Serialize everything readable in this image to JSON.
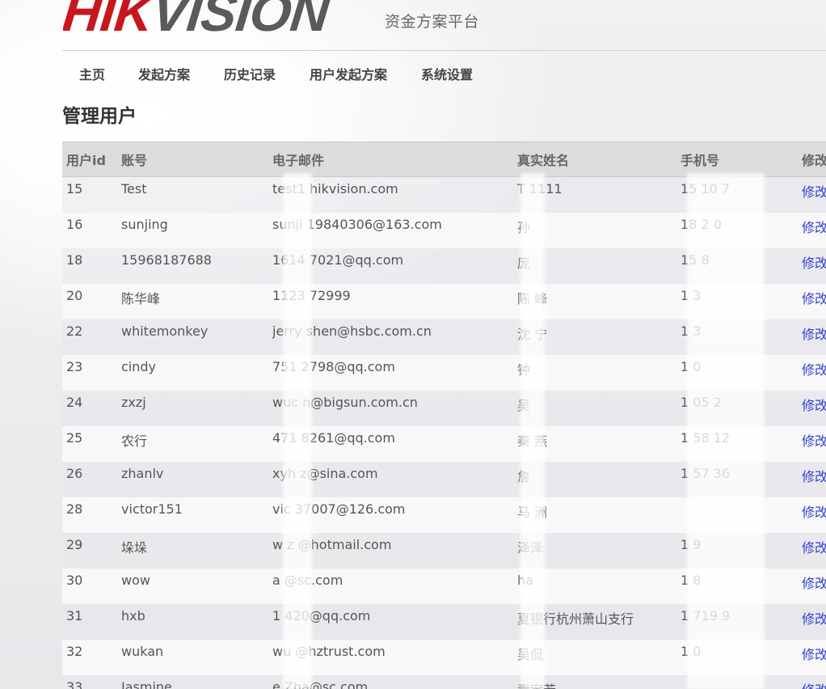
{
  "brand": {
    "logo_red": "HIK",
    "logo_gray": "VISION",
    "platform_title": "资金方案平台"
  },
  "nav": {
    "items": [
      {
        "label": "主页"
      },
      {
        "label": "发起方案"
      },
      {
        "label": "历史记录"
      },
      {
        "label": "用户发起方案"
      },
      {
        "label": "系统设置"
      }
    ]
  },
  "page": {
    "title": "管理用户"
  },
  "table": {
    "columns": [
      "用户id",
      "账号",
      "电子邮件",
      "真实姓名",
      "手机号",
      "修改"
    ],
    "rows": [
      {
        "id": "15",
        "account": "Test",
        "email": "test1 hikvision.com",
        "name": "T 1111",
        "phone": "15 10 7",
        "edit": "修改"
      },
      {
        "id": "16",
        "account": "sunjing",
        "email": "sunji 19840306@163.com",
        "name": "孙",
        "phone": "18 2 0",
        "edit": "修改"
      },
      {
        "id": "18",
        "account": "15968187688",
        "email": "1614 7021@qq.com",
        "name": "庞",
        "phone": "15 8",
        "edit": "修改"
      },
      {
        "id": "20",
        "account": "陈华峰",
        "email": "1123 72999",
        "name": "陈 峰",
        "phone": "1 3",
        "edit": "修改"
      },
      {
        "id": "22",
        "account": "whitemonkey",
        "email": "jerry shen@hsbc.com.cn",
        "name": "沈 宁",
        "phone": "1 3",
        "edit": "修改"
      },
      {
        "id": "23",
        "account": "cindy",
        "email": "751 2798@qq.com",
        "name": "钟",
        "phone": "1 0",
        "edit": "修改"
      },
      {
        "id": "24",
        "account": "zxzj",
        "email": "wuc n@bigsun.com.cn",
        "name": "吴",
        "phone": "1 05 2",
        "edit": "修改"
      },
      {
        "id": "25",
        "account": "农行",
        "email": "471 8261@qq.com",
        "name": "秦 燕",
        "phone": "1 58 12",
        "edit": "修改"
      },
      {
        "id": "26",
        "account": "zhanlv",
        "email": "xyh z@sina.com",
        "name": "詹",
        "phone": "1 57 36",
        "edit": "修改"
      },
      {
        "id": "28",
        "account": "victor151",
        "email": "vic 37007@126.com",
        "name": "马 洲",
        "phone": "",
        "edit": "修改"
      },
      {
        "id": "29",
        "account": "垛垛",
        "email": "w z @hotmail.com",
        "name": "泽泽",
        "phone": "1 9",
        "edit": "修改"
      },
      {
        "id": "30",
        "account": "wow",
        "email": "a @sc.com",
        "name": "ha",
        "phone": "1 8",
        "edit": "修改"
      },
      {
        "id": "31",
        "account": "hxb",
        "email": "1 420@qq.com",
        "name": "夏银行杭州萧山支行",
        "phone": "1 719 9",
        "edit": "修改"
      },
      {
        "id": "32",
        "account": "wukan",
        "email": "wu @hztrust.com",
        "name": "吴侃",
        "phone": "1 0",
        "edit": "修改"
      },
      {
        "id": "33",
        "account": "Jasmine",
        "email": "e.Zha@sc.com",
        "name": "責宇若",
        "phone": "",
        "edit": "修改"
      }
    ]
  }
}
